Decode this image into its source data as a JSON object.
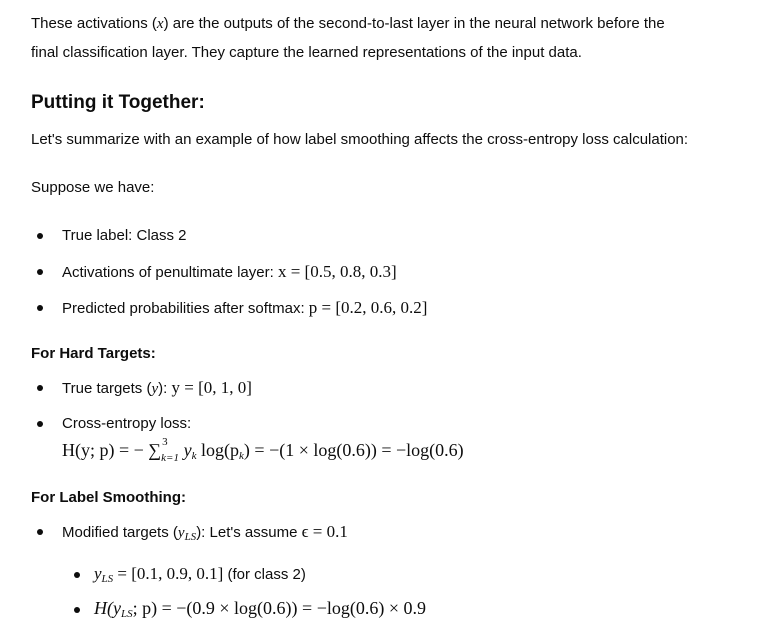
{
  "intro": {
    "line1_a": "These activations (",
    "line1_var": "x",
    "line1_b": ") are the outputs of the second-to-last layer in the neural network before the",
    "line2": "final classification layer. They capture the learned representations of the input data."
  },
  "section": {
    "heading": "Putting it Together:",
    "summary": "Let's summarize with an example of how label smoothing affects the cross-entropy loss calculation:",
    "suppose": "Suppose we have:"
  },
  "givens": {
    "true_label": "True label: Class 2",
    "activations_label": "Activations of penultimate layer: ",
    "activations_math": "x = [0.5, 0.8, 0.3]",
    "probs_label": "Predicted probabilities after softmax: ",
    "probs_math": "p = [0.2, 0.6, 0.2]"
  },
  "hard": {
    "heading": "For Hard Targets:",
    "targets_label_a": "True targets (",
    "targets_var": "y",
    "targets_label_b": "): ",
    "targets_math": "y = [0, 1, 0]",
    "loss_label": "Cross-entropy loss:",
    "loss_lhs": "H(y; p) = −",
    "loss_sum": "∑",
    "loss_sum_sup": "3",
    "loss_sum_sub": "k=1",
    "loss_rhs": " y",
    "loss_rhs_sub": "k",
    "loss_rhs_b": " log(p",
    "loss_rhs_sub2": "k",
    "loss_rhs_c": ") = −(1 × log(0.6)) = −log(0.6)"
  },
  "smooth": {
    "heading": "For Label Smoothing:",
    "mod_label_a": "Modified targets (",
    "mod_var": "y",
    "mod_var_sub": "LS",
    "mod_label_b": "): Let's assume ",
    "mod_math": "ϵ = 0.1",
    "yls_var": "y",
    "yls_sub": "LS",
    "yls_math": " = [0.1, 0.9, 0.1]",
    "yls_note": " (for class 2)",
    "h_a": "H(y",
    "h_sub": "LS",
    "h_b": "; p) = −(0.9 × log(0.6)) = −log(0.6) × 0.9"
  }
}
